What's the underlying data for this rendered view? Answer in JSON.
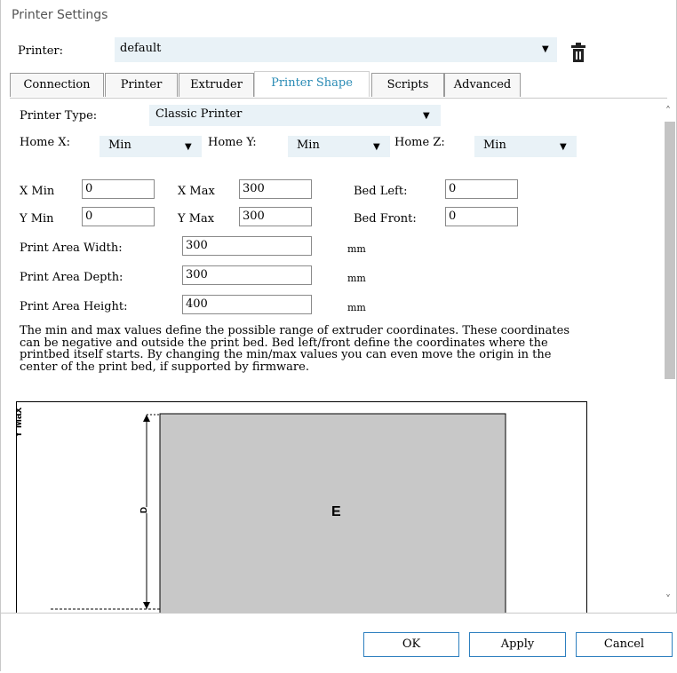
{
  "window": {
    "title": "Printer Settings"
  },
  "printer": {
    "label": "Printer:",
    "value": "default"
  },
  "tabs": [
    "Connection",
    "Printer",
    "Extruder",
    "Printer Shape",
    "Scripts",
    "Advanced"
  ],
  "shape": {
    "printer_type_label": "Printer Type:",
    "printer_type_value": "Classic Printer",
    "home_x_label": "Home X:",
    "home_x_value": "Min",
    "home_y_label": "Home Y:",
    "home_y_value": "Min",
    "home_z_label": "Home Z:",
    "home_z_value": "Min",
    "x_min_label": "X Min",
    "x_min_value": "0",
    "x_max_label": "X Max",
    "x_max_value": "300",
    "bed_left_label": "Bed Left:",
    "bed_left_value": "0",
    "y_min_label": "Y Min",
    "y_min_value": "0",
    "y_max_label": "Y Max",
    "y_max_value": "300",
    "bed_front_label": "Bed Front:",
    "bed_front_value": "0",
    "width_label": "Print Area Width:",
    "width_value": "300",
    "depth_label": "Print Area Depth:",
    "depth_value": "300",
    "height_label": "Print Area Height:",
    "height_value": "400",
    "unit": "mm",
    "description": "The min and max values define the possible range of extruder coordinates. These coordinates can be negative and outside the print bed. Bed left/front define the coordinates where the printbed itself starts. By changing the min/max values you can even move the origin in the center of the print bed, if supported by firmware."
  },
  "diagram": {
    "y_axis_label": "Y Max",
    "depth_marker": "D",
    "extruder_label": "E",
    "bed_color": "#c8c8c8"
  },
  "buttons": {
    "ok": "OK",
    "apply": "Apply",
    "cancel": "Cancel"
  },
  "colors": {
    "accent": "#2a8bb5",
    "button_border": "#2d7fbf",
    "select_bg": "#e9f2f7"
  },
  "icons": {
    "delete": "trash-icon",
    "dropdown": "caret-down-icon"
  }
}
